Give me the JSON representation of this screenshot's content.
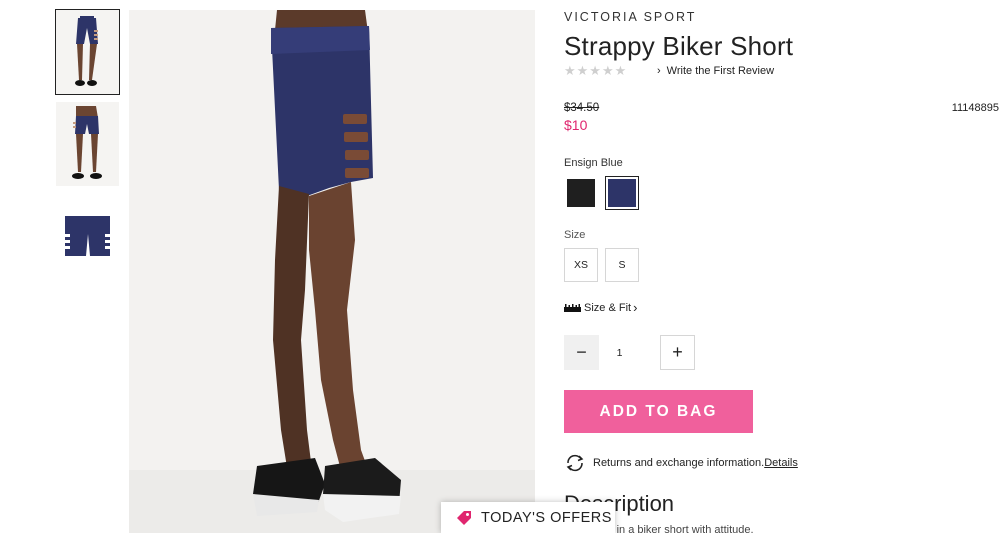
{
  "thumbnails": [
    {
      "alt": "front view",
      "active": true
    },
    {
      "alt": "back view",
      "active": false
    },
    {
      "alt": "flat view",
      "active": false
    }
  ],
  "product": {
    "brand": "VICTORIA SPORT",
    "title": "Strappy Biker Short",
    "stars": "★★★★★",
    "review_link": "Write the First Review",
    "old_price": "$34.50",
    "new_price": "$10",
    "sku": "11148895"
  },
  "color": {
    "label": "Ensign Blue",
    "swatches": [
      {
        "name": "Black",
        "hex": "#1f1f1f",
        "selected": false
      },
      {
        "name": "Ensign Blue",
        "hex": "#2d3468",
        "selected": true
      }
    ]
  },
  "size": {
    "label": "Size",
    "options": [
      "XS",
      "S"
    ]
  },
  "size_fit": {
    "label": "Size & Fit",
    "chevron": "›"
  },
  "quantity": {
    "value": "1",
    "minus": "−",
    "plus": "+"
  },
  "add_to_bag": {
    "label": "ADD TO BAG",
    "color": "#f0609c"
  },
  "returns": {
    "text": "Returns and exchange information.",
    "link": "Details"
  },
  "description": {
    "title": "Description",
    "text": "Puts sport in a biker short with attitude."
  },
  "offers": {
    "label": "TODAY'S OFFERS"
  },
  "colors": {
    "accent_pink": "#e0266f",
    "navy": "#2d3468"
  }
}
